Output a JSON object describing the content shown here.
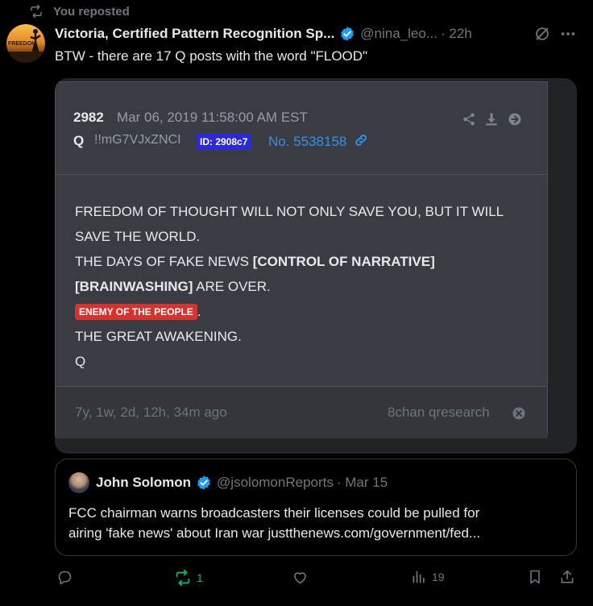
{
  "repost": {
    "label": "You reposted"
  },
  "avatar": {
    "caption": "FREEDOM"
  },
  "tweet": {
    "author_name": "Victoria, Certified Pattern Recognition Sp...",
    "handle": "@nina_leo...",
    "time": "· 22h",
    "text": "BTW - there are 17 Q posts with the word \"FLOOD\""
  },
  "qpost": {
    "number": "2982",
    "date": "Mar 06, 2019 11:58:00 AM EST",
    "author": "Q",
    "tripcode": "!!mG7VJxZNCI",
    "id_badge": "ID: 2908c7",
    "post_no": "No. 5538158",
    "lines": {
      "l1": "FREEDOM OF THOUGHT WILL NOT ONLY SAVE YOU, BUT IT WILL",
      "l2": "SAVE THE WORLD.",
      "l3a": "THE DAYS OF FAKE NEWS ",
      "l3b": "[CONTROL OF NARRATIVE]",
      "l4a": "[BRAINWASHING]",
      "l4b": " ARE OVER.",
      "enemy": "ENEMY OF THE PEOPLE",
      "enemy_after": ".",
      "l6": "THE GREAT AWAKENING.",
      "l7": "Q"
    },
    "ago": "7y, 1w, 2d, 12h, 34m ago",
    "source": "8chan qresearch",
    "colors": {
      "badge_blue": "#2b2ad6",
      "link_blue": "#3a8ee6",
      "enemy_red": "#d7332e"
    }
  },
  "quoted_tweet": {
    "author_name": "John Solomon",
    "handle": "@jsolomonReports",
    "time": "· Mar 15",
    "line1": "FCC chairman warns broadcasters their licenses could be pulled for",
    "line2": "airing 'fake news' about Iran war justthenews.com/government/fed..."
  },
  "actions": {
    "reply_count": "",
    "repost_count": "1",
    "like_count": "",
    "views_count": "19"
  },
  "colors": {
    "verified": "#1d9bf0",
    "repost_green": "#00ba7c",
    "muted": "#71767b"
  }
}
